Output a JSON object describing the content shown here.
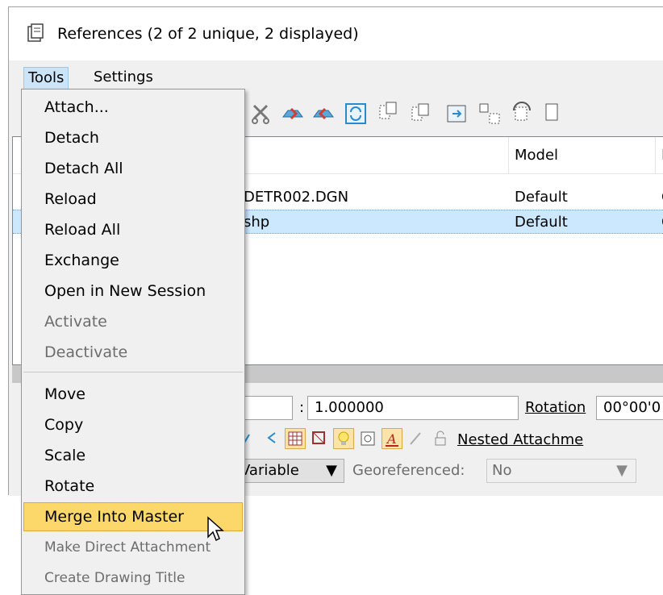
{
  "window": {
    "title": "References (2 of 2 unique, 2 displayed)"
  },
  "menubar": {
    "tools": "Tools",
    "settings": "Settings"
  },
  "list": {
    "columns": [
      "Model",
      "D"
    ],
    "rows": [
      {
        "file": "DETR002.DGN",
        "model": "Default",
        "extra": "C"
      },
      {
        "file": "shp",
        "model": "Default",
        "extra": "C"
      }
    ]
  },
  "props": {
    "scale_sep": ":",
    "scale_value": "1.000000",
    "rotation_label": "Rotation",
    "rotation_value": "00°00'0",
    "nested_label": "Nested Attachme",
    "line_style_value": "Variable",
    "georef_label": "Georeferenced:",
    "georef_value": "No"
  },
  "tools_menu": {
    "items": [
      {
        "label": "Attach...",
        "enabled": true
      },
      {
        "label": "Detach",
        "enabled": true
      },
      {
        "label": "Detach All",
        "enabled": true
      },
      {
        "label": "Reload",
        "enabled": true
      },
      {
        "label": "Reload All",
        "enabled": true
      },
      {
        "label": "Exchange",
        "enabled": true
      },
      {
        "label": "Open in New Session",
        "enabled": true
      },
      {
        "label": "Activate",
        "enabled": false
      },
      {
        "label": "Deactivate",
        "enabled": false
      },
      {
        "label": "Move",
        "enabled": true
      },
      {
        "label": "Copy",
        "enabled": true
      },
      {
        "label": "Scale",
        "enabled": true
      },
      {
        "label": "Rotate",
        "enabled": true
      },
      {
        "label": "Merge Into Master",
        "enabled": true,
        "highlighted": true
      },
      {
        "label": "Make Direct Attachment",
        "enabled": false
      },
      {
        "label": "Create Drawing Title",
        "enabled": false
      }
    ]
  },
  "colors": {
    "highlight": "#fcd86a",
    "selection": "#cce8ff",
    "menu_active": "#cce4f7"
  }
}
